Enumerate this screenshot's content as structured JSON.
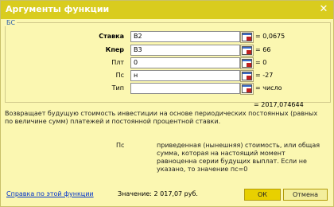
{
  "dialog": {
    "title": "Аргументы функции",
    "close_glyph": "✕",
    "function_name": "БС"
  },
  "arguments": [
    {
      "label": "Ставка",
      "bold": true,
      "input": "B2",
      "value": "= 0,0675"
    },
    {
      "label": "Кпер",
      "bold": true,
      "input": "B3",
      "value": "= 66"
    },
    {
      "label": "Плт",
      "bold": false,
      "input": "0",
      "value": "= 0"
    },
    {
      "label": "Пс",
      "bold": false,
      "input": "н",
      "value": "= -27"
    },
    {
      "label": "Тип",
      "bold": false,
      "input": "",
      "value": "= число"
    }
  ],
  "result": "= 2017,074644",
  "description": "Возвращает будущую стоимость инвестиции на основе периодических постоянных (равных по величине сумм) платежей и постоянной процентной ставки.",
  "param_description": {
    "label": "Пс",
    "text": "приведенная (нынешняя) стоимость, или общая сумма, которая на настоящий момент равноценна серии будущих выплат. Если не указано, то значение пс=0"
  },
  "footer": {
    "help_link": "Справка по этой функции",
    "value_label": "Значение:",
    "value": "2 017,07 руб.",
    "ok_label": "ОК",
    "cancel_label": "Отмена"
  },
  "colors": {
    "titlebar": "#d9cc1e",
    "background": "#fbf7b1",
    "ok_button": "#e8d000",
    "link": "#0033cc"
  },
  "icons": {
    "close": "close-icon",
    "range_picker": "collapse-dialog-icon"
  }
}
